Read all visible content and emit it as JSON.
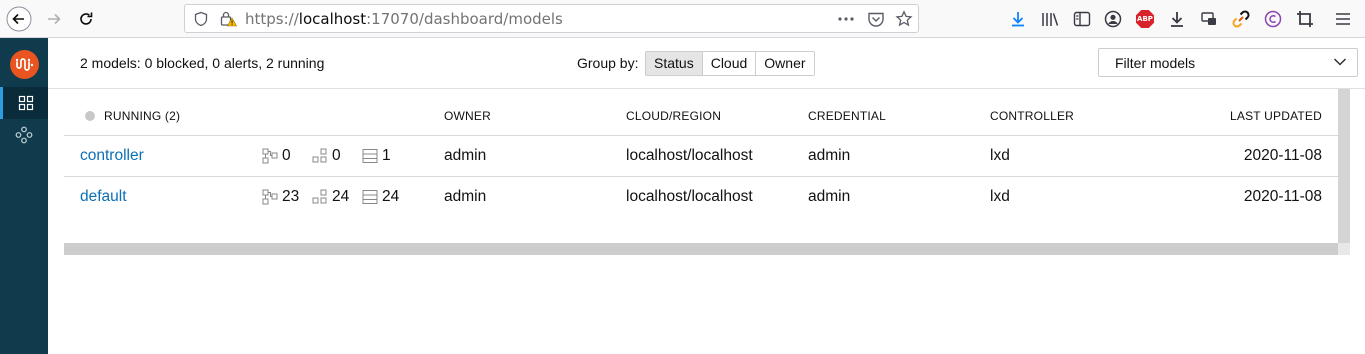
{
  "browser": {
    "url_scheme": "https://",
    "url_host": "localhost",
    "url_path": ":17070/dashboard/models",
    "adblock_label": "ABP"
  },
  "header": {
    "summary": "2 models: 0 blocked, 0 alerts, 2 running",
    "group_by_label": "Group by:",
    "group_options": [
      {
        "label": "Status",
        "active": true
      },
      {
        "label": "Cloud",
        "active": false
      },
      {
        "label": "Owner",
        "active": false
      }
    ],
    "filter_label": "Filter models"
  },
  "table": {
    "columns": {
      "status": "RUNNING (2)",
      "owner": "OWNER",
      "cloud": "CLOUD/REGION",
      "credential": "CREDENTIAL",
      "controller": "CONTROLLER",
      "updated": "LAST UPDATED"
    },
    "rows": [
      {
        "name": "controller",
        "apps": "0",
        "units": "0",
        "machines": "1",
        "owner": "admin",
        "cloud": "localhost/localhost",
        "credential": "admin",
        "controller": "lxd",
        "updated": "2020-11-08"
      },
      {
        "name": "default",
        "apps": "23",
        "units": "24",
        "machines": "24",
        "owner": "admin",
        "cloud": "localhost/localhost",
        "credential": "admin",
        "controller": "lxd",
        "updated": "2020-11-08"
      }
    ]
  },
  "colors": {
    "sidebar": "#0f3b4c",
    "logo": "#e95420",
    "link": "#0b6fb6",
    "download_icon": "#0a84ff"
  }
}
